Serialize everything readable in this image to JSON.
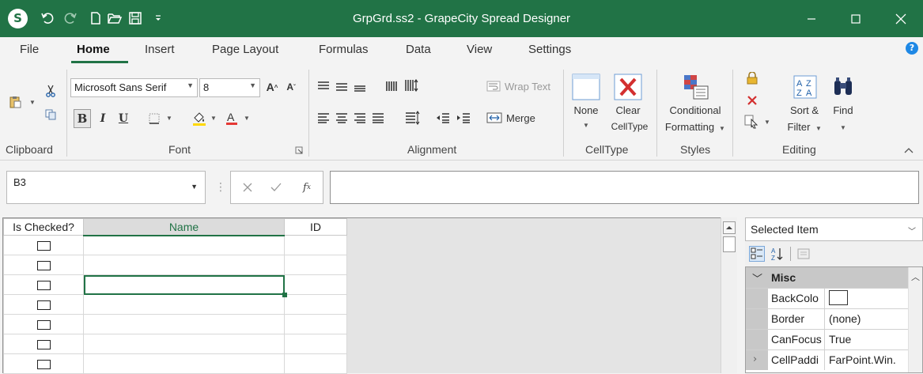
{
  "window": {
    "title": "GrpGrd.ss2 - GrapeCity Spread Designer",
    "colors": {
      "titlebar": "#217346",
      "accent": "#217346"
    }
  },
  "quick_access": [
    "undo-icon",
    "redo-icon",
    "new-file-icon",
    "open-folder-icon",
    "save-icon",
    "customize-dropdown-icon"
  ],
  "tabs": [
    {
      "label": "File"
    },
    {
      "label": "Home",
      "active": true
    },
    {
      "label": "Insert"
    },
    {
      "label": "Page Layout"
    },
    {
      "label": "Formulas"
    },
    {
      "label": "Data"
    },
    {
      "label": "View"
    },
    {
      "label": "Settings"
    }
  ],
  "ribbon": {
    "groups": {
      "clipboard": "Clipboard",
      "font": "Font",
      "alignment": "Alignment",
      "celltype": "CellType",
      "styles": "Styles",
      "editing": "Editing"
    },
    "font": {
      "family": "Microsoft Sans Serif",
      "size": "8",
      "bold": "B",
      "italic": "I",
      "underline": "U"
    },
    "alignment": {
      "wrap_text": "Wrap Text",
      "merge": "Merge"
    },
    "celltype": {
      "none_line1": "None",
      "clear_line1": "Clear",
      "clear_line2": "CellType"
    },
    "styles": {
      "conditional_line1": "Conditional",
      "conditional_line2": "Formatting"
    },
    "editing": {
      "sort_line1": "Sort &",
      "sort_line2": "Filter",
      "find_label": "Find"
    }
  },
  "formula_bar": {
    "name_box": "B3",
    "formula": ""
  },
  "sheet": {
    "columns": [
      "Is Checked?",
      "Name",
      "ID"
    ],
    "rows": [
      {
        "checked": false,
        "name": "",
        "id": ""
      },
      {
        "checked": false,
        "name": "",
        "id": ""
      },
      {
        "checked": false,
        "name": "",
        "id": ""
      },
      {
        "checked": false,
        "name": "",
        "id": ""
      },
      {
        "checked": false,
        "name": "",
        "id": ""
      },
      {
        "checked": false,
        "name": "",
        "id": ""
      },
      {
        "checked": false,
        "name": "",
        "id": ""
      }
    ],
    "selected_cell": "B3"
  },
  "property_panel": {
    "selector": "Selected Item",
    "category": "Misc",
    "properties": [
      {
        "name": "BackColo",
        "value": "",
        "swatch": "#ffffff"
      },
      {
        "name": "Border",
        "value": "(none)"
      },
      {
        "name": "CanFocus",
        "value": "True"
      },
      {
        "name": "CellPaddi",
        "value": "FarPoint.Win.",
        "expandable": true
      }
    ]
  }
}
